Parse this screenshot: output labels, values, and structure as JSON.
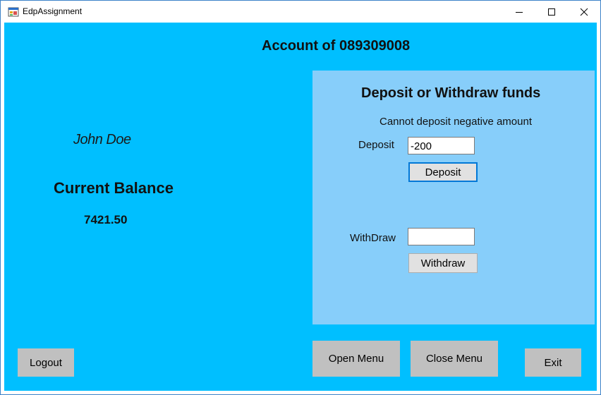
{
  "window": {
    "title": "EdpAssignment",
    "icon": "winforms-app-icon",
    "controls": [
      "minimize-icon",
      "maximize-icon",
      "close-icon"
    ]
  },
  "colors": {
    "background": "#00bfff",
    "panel": "#87cefa",
    "button": "#e1e1e1",
    "flat_button": "#c0c0c0",
    "focus": "#0078d7"
  },
  "header": {
    "account_title": "Account of 089309008"
  },
  "customer": {
    "name": "John Doe",
    "balance_heading": "Current Balance",
    "balance_value": "7421.50"
  },
  "funds_panel": {
    "title": "Deposit or Withdraw funds",
    "message": "Cannot deposit negative amount",
    "deposit_label": "Deposit",
    "deposit_value": "-200",
    "deposit_button": "Deposit",
    "withdraw_label": "WithDraw",
    "withdraw_value": "",
    "withdraw_button": "Withdraw"
  },
  "footer": {
    "logout": "Logout",
    "open_menu": "Open Menu",
    "close_menu": "Close Menu",
    "exit": "Exit"
  }
}
